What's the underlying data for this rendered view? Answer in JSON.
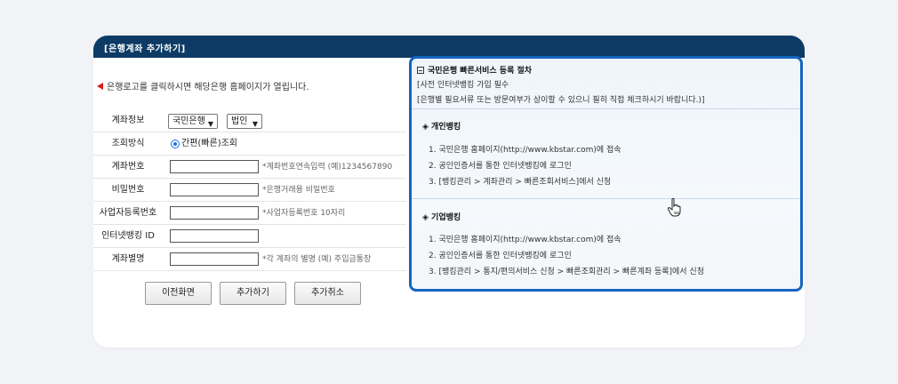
{
  "header": {
    "title": "[은행계좌 추가하기]"
  },
  "notice": "은행로고를 클릭하시면 해당은행 홈페이지가 열립니다.",
  "form": {
    "account_info_label": "계좌정보",
    "bank_select": "국민은행",
    "type_select": "법인",
    "query_method_label": "조회방식",
    "query_method_option": "간편(빠른)조회",
    "account_number_label": "계좌번호",
    "account_number_hint": "*계좌번호연속입력 (예)1234567890",
    "password_label": "비밀번호",
    "password_hint": "*은행거래용 비밀번호",
    "bizno_label": "사업자등록번호",
    "bizno_hint": "*사업자등록번호 10자리",
    "ibank_id_label": "인터넷뱅킹 ID",
    "alias_label": "계좌별명",
    "alias_hint": "*각 계좌의 별명 (예) 주입금통장"
  },
  "buttons": {
    "prev": "이전화면",
    "add": "추가하기",
    "cancel": "추가취소"
  },
  "panel": {
    "title": "국민은행 빠른서비스 등록 절차",
    "line1": "[사전 인터넷뱅킹 가입 필수",
    "line2": "[은행별 필요서류 또는 방문여부가 상이할 수 있으니 필히 직접 체크하시기 바랍니다.)]",
    "personal": {
      "title": "◈ 개인뱅킹",
      "steps": [
        "1. 국민은행 홈페이지(http://www.kbstar.com)에 접속",
        "2. 공인인증서를 통한 인터넷뱅킹에 로그인",
        "3. [뱅킹관리 > 계좌관리 > 빠른조회서비스]에서 신청"
      ]
    },
    "corporate": {
      "title": "◈ 기업뱅킹",
      "steps": [
        "1. 국민은행 홈페이지(http://www.kbstar.com)에 접속",
        "2. 공인인증서를 통한 인터넷뱅킹에 로그인",
        "3. [뱅킹관리 > 통지/편의서비스 신청 > 빠른조회관리 > 빠른계좌 등록]에서 신청"
      ]
    }
  },
  "colors": {
    "header_bg": "#0d3b66",
    "panel_border": "#1565c0",
    "notice_arrow": "#d81b1b"
  }
}
